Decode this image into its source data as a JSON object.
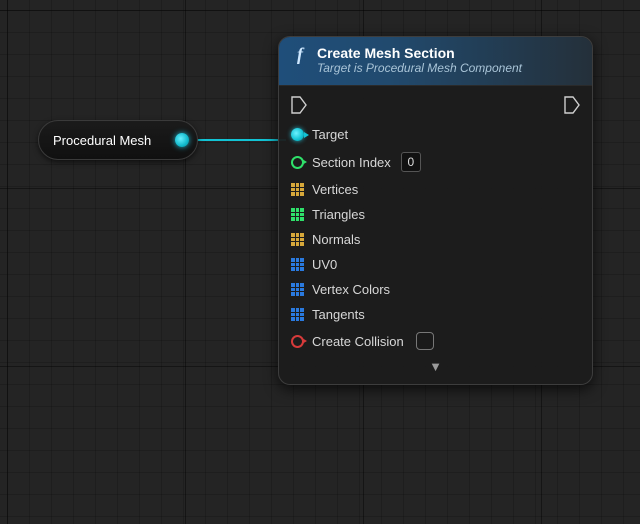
{
  "variable_node": {
    "label": "Procedural Mesh"
  },
  "function_node": {
    "icon_glyph": "f",
    "title": "Create Mesh Section",
    "subtitle": "Target is Procedural Mesh Component",
    "pins": {
      "target": "Target",
      "section_index": {
        "label": "Section Index",
        "value": "0"
      },
      "vertices": "Vertices",
      "triangles": "Triangles",
      "normals": "Normals",
      "uv0": "UV0",
      "vertex_colors": "Vertex Colors",
      "tangents": "Tangents",
      "create_collision": "Create Collision"
    },
    "expand_glyph": "▼"
  }
}
